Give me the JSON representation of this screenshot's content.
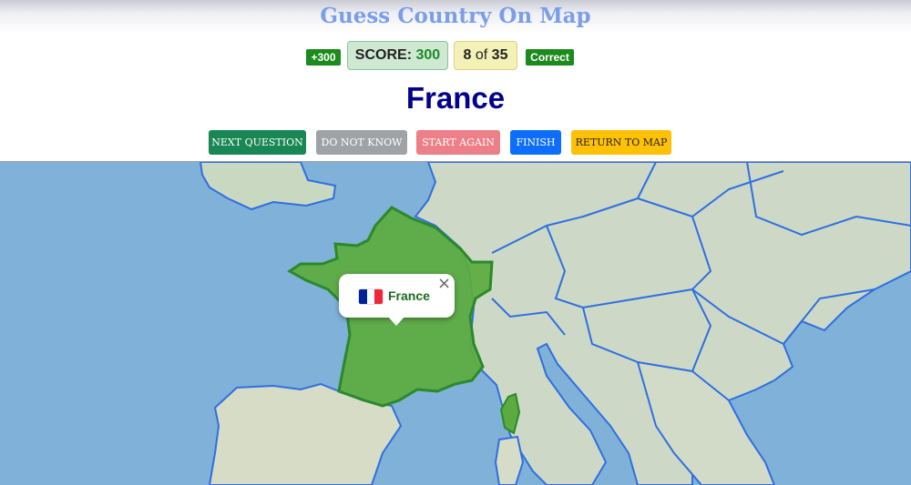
{
  "header": {
    "title": "Guess Country On Map"
  },
  "scorebar": {
    "points_gained": "+300",
    "score_label": "SCORE:",
    "score_value": "300",
    "progress_current": "8",
    "progress_of": "of",
    "progress_total": "35",
    "status": "Correct"
  },
  "question": {
    "country": "France"
  },
  "buttons": {
    "next": "Next Question",
    "dont_know": "Do not know",
    "start_again": "Start Again",
    "finish": "Finish",
    "return_to_map": "Return to map"
  },
  "map": {
    "highlight_color": "#5cab3f",
    "border_color": "#2f6fe0",
    "popup": {
      "country_name": "France",
      "flag_colors": [
        "#002395",
        "#ffffff",
        "#ed2939"
      ],
      "close_icon": "close-icon"
    }
  }
}
